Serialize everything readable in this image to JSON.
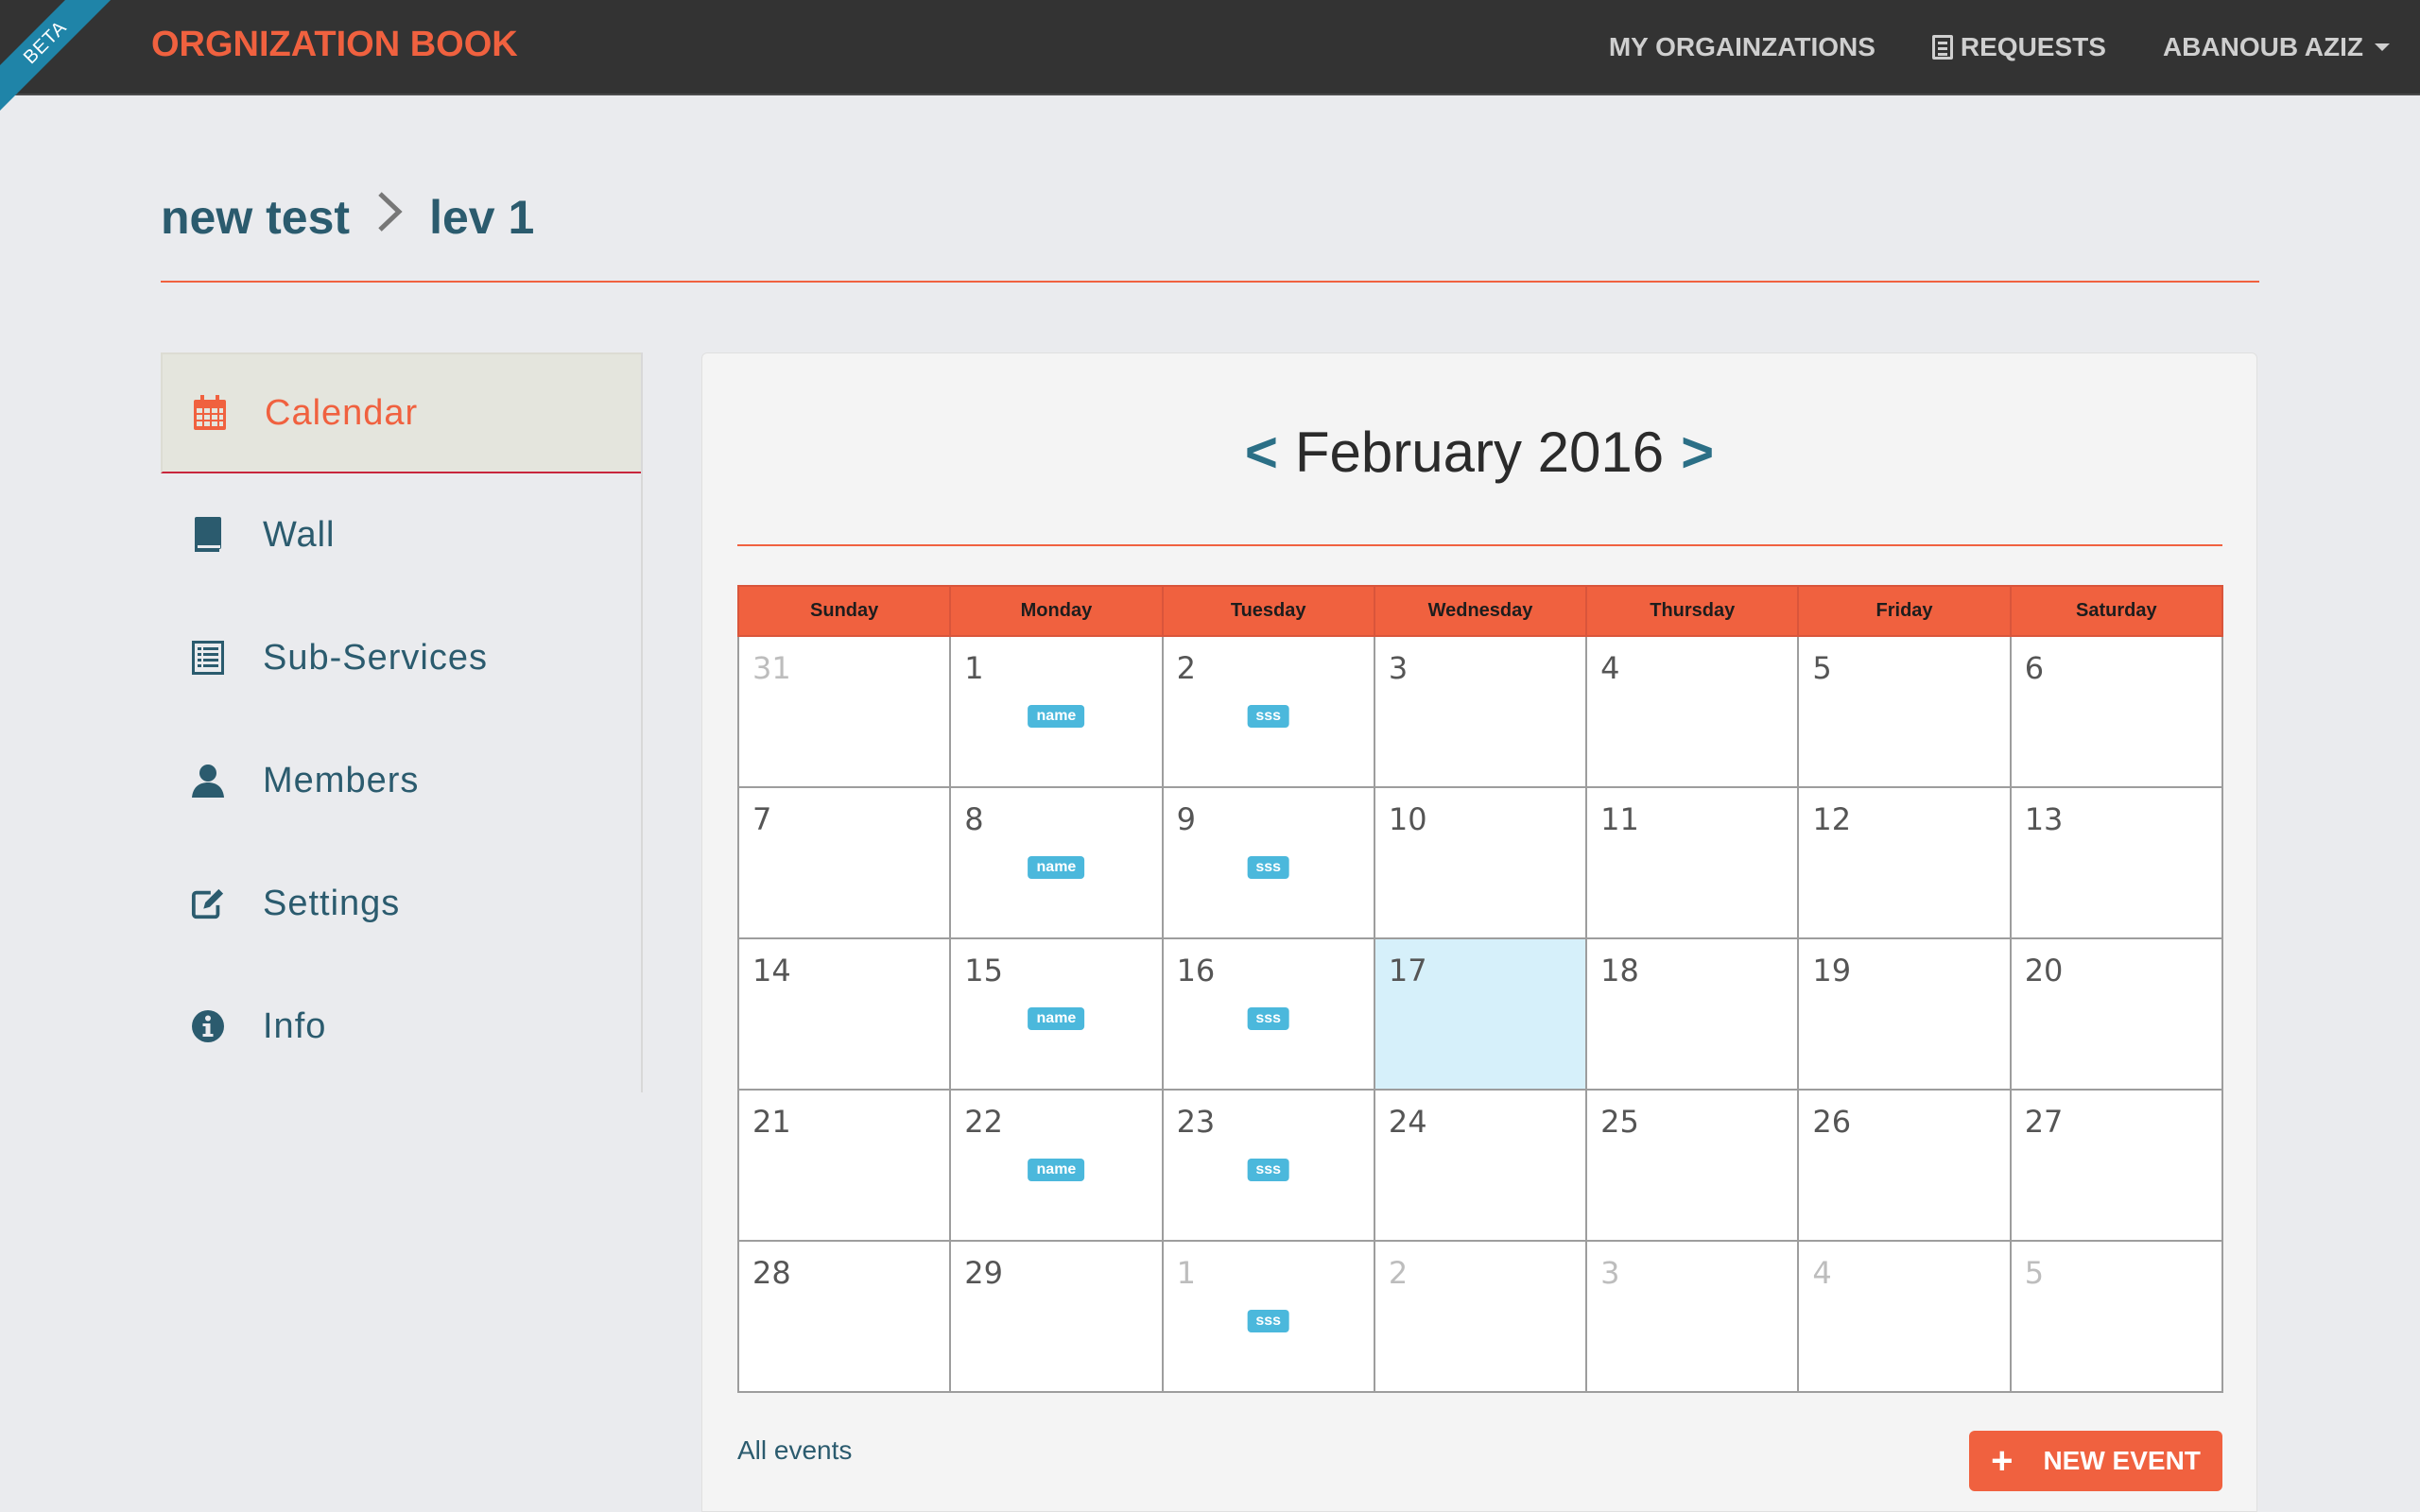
{
  "navbar": {
    "beta_label": "BETA",
    "brand": "ORGNIZATION BOOK",
    "links": {
      "my_orgs": "MY ORGAINZATIONS",
      "requests": "REQUESTS",
      "user": "ABANOUB AZIZ"
    }
  },
  "breadcrumb": {
    "parent": "new test",
    "separator": ">",
    "current": "lev 1"
  },
  "sidebar": {
    "items": [
      {
        "label": "Calendar",
        "icon": "calendar-icon",
        "active": true
      },
      {
        "label": "Wall",
        "icon": "book-icon"
      },
      {
        "label": "Sub-Services",
        "icon": "list-icon"
      },
      {
        "label": "Members",
        "icon": "user-icon"
      },
      {
        "label": "Settings",
        "icon": "edit-icon"
      },
      {
        "label": "Info",
        "icon": "info-icon"
      }
    ]
  },
  "calendar": {
    "prev_label": "<",
    "next_label": ">",
    "month_title": "February 2016",
    "weekdays": [
      "Sunday",
      "Monday",
      "Tuesday",
      "Wednesday",
      "Thursday",
      "Friday",
      "Saturday"
    ],
    "today": 17,
    "weeks": [
      [
        {
          "d": "31",
          "other": true
        },
        {
          "d": "1",
          "event": "name"
        },
        {
          "d": "2",
          "event": "sss"
        },
        {
          "d": "3"
        },
        {
          "d": "4"
        },
        {
          "d": "5"
        },
        {
          "d": "6"
        }
      ],
      [
        {
          "d": "7"
        },
        {
          "d": "8",
          "event": "name"
        },
        {
          "d": "9",
          "event": "sss"
        },
        {
          "d": "10"
        },
        {
          "d": "11"
        },
        {
          "d": "12"
        },
        {
          "d": "13"
        }
      ],
      [
        {
          "d": "14"
        },
        {
          "d": "15",
          "event": "name"
        },
        {
          "d": "16",
          "event": "sss"
        },
        {
          "d": "17",
          "today": true
        },
        {
          "d": "18"
        },
        {
          "d": "19"
        },
        {
          "d": "20"
        }
      ],
      [
        {
          "d": "21"
        },
        {
          "d": "22",
          "event": "name"
        },
        {
          "d": "23",
          "event": "sss"
        },
        {
          "d": "24"
        },
        {
          "d": "25"
        },
        {
          "d": "26"
        },
        {
          "d": "27"
        }
      ],
      [
        {
          "d": "28"
        },
        {
          "d": "29"
        },
        {
          "d": "1",
          "other": true,
          "event": "sss"
        },
        {
          "d": "2",
          "other": true
        },
        {
          "d": "3",
          "other": true
        },
        {
          "d": "4",
          "other": true
        },
        {
          "d": "5",
          "other": true
        }
      ]
    ],
    "all_events_label": "All events",
    "new_event_label": "NEW EVENT",
    "new_event_icon": "+"
  },
  "colors": {
    "accent": "#f0613f",
    "navbar_bg": "#333333",
    "link": "#2b5b6e",
    "badge": "#4bb8dc",
    "today_bg": "#d6f0fa"
  }
}
